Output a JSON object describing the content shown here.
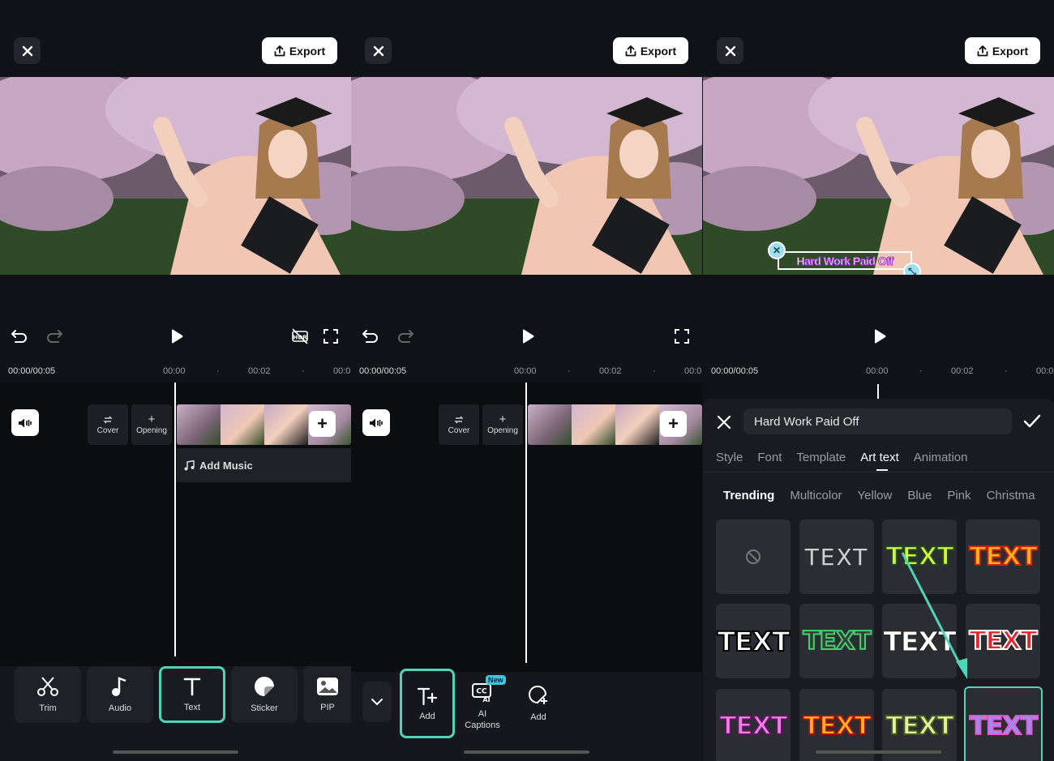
{
  "header": {
    "export_label": "Export"
  },
  "timeline": {
    "time_current": "00:00/00:05",
    "tick_1": "00:00",
    "tick_2": "00:02",
    "tick_3_partial": "00:0",
    "cover_label": "Cover",
    "opening_label": "Opening",
    "add_music_label": "Add Music"
  },
  "screen1": {
    "tools": [
      {
        "label": "Trim",
        "icon": "scissors-icon"
      },
      {
        "label": "Audio",
        "icon": "music-note-icon"
      },
      {
        "label": "Text",
        "icon": "text-t-icon"
      },
      {
        "label": "Sticker",
        "icon": "sticker-icon"
      },
      {
        "label": "PIP",
        "icon": "pip-image-icon"
      }
    ]
  },
  "screen2": {
    "tools": [
      {
        "label": "Add",
        "icon": "text-add-icon"
      },
      {
        "label": "AI\nCaptions",
        "icon": "cc-ai-icon",
        "badge": "New"
      },
      {
        "label": "Add",
        "icon": "sticker-add-icon"
      }
    ]
  },
  "screen3": {
    "overlay_text": "Hard Work Paid Off",
    "input_value": "Hard Work Paid Off",
    "tabs": [
      "Style",
      "Font",
      "Template",
      "Art text",
      "Animation"
    ],
    "active_tab": "Art text",
    "categories": [
      "Trending",
      "Multicolor",
      "Yellow",
      "Blue",
      "Pink",
      "Christma"
    ],
    "active_category": "Trending",
    "grid_sample": "TEXT",
    "accent": "#4fd4b8"
  }
}
